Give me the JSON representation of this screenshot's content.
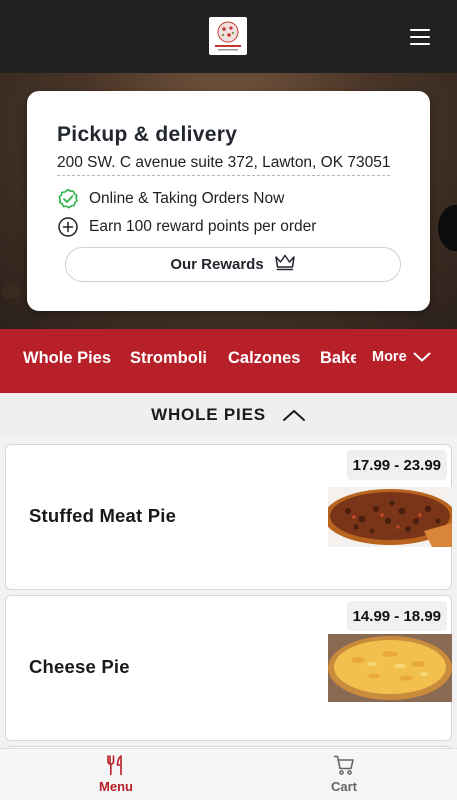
{
  "header": {
    "logo_text": "Vino Pasta & Pizza",
    "menu_icon": "hamburger-menu-icon"
  },
  "store": {
    "title": "Pickup & delivery",
    "address": "200 SW. C avenue suite 372, Lawton, OK 73051",
    "status": "Online & Taking Orders Now",
    "rewards_info": "Earn 100 reward points per order",
    "rewards_button": "Our Rewards"
  },
  "categories": {
    "items": [
      "Whole Pies",
      "Stromboli",
      "Calzones",
      "Bake"
    ],
    "more_label": "More"
  },
  "section": {
    "title": "WHOLE PIES"
  },
  "menu_items": [
    {
      "name": "Stuffed Meat Pie",
      "price": "17.99 - 23.99"
    },
    {
      "name": "Cheese Pie",
      "price": "14.99 - 18.99"
    }
  ],
  "bottom_nav": {
    "menu_label": "Menu",
    "cart_label": "Cart"
  },
  "colors": {
    "brand_red": "#b82029",
    "topbar": "#222222",
    "status_green": "#2fb34a"
  },
  "icons": {
    "status": "check-badge-icon",
    "rewards_info": "plus-circle-icon",
    "rewards_button": "crown-icon",
    "section_toggle": "chevron-up-icon",
    "menu_tab": "fork-knife-icon",
    "cart_tab": "cart-icon"
  }
}
